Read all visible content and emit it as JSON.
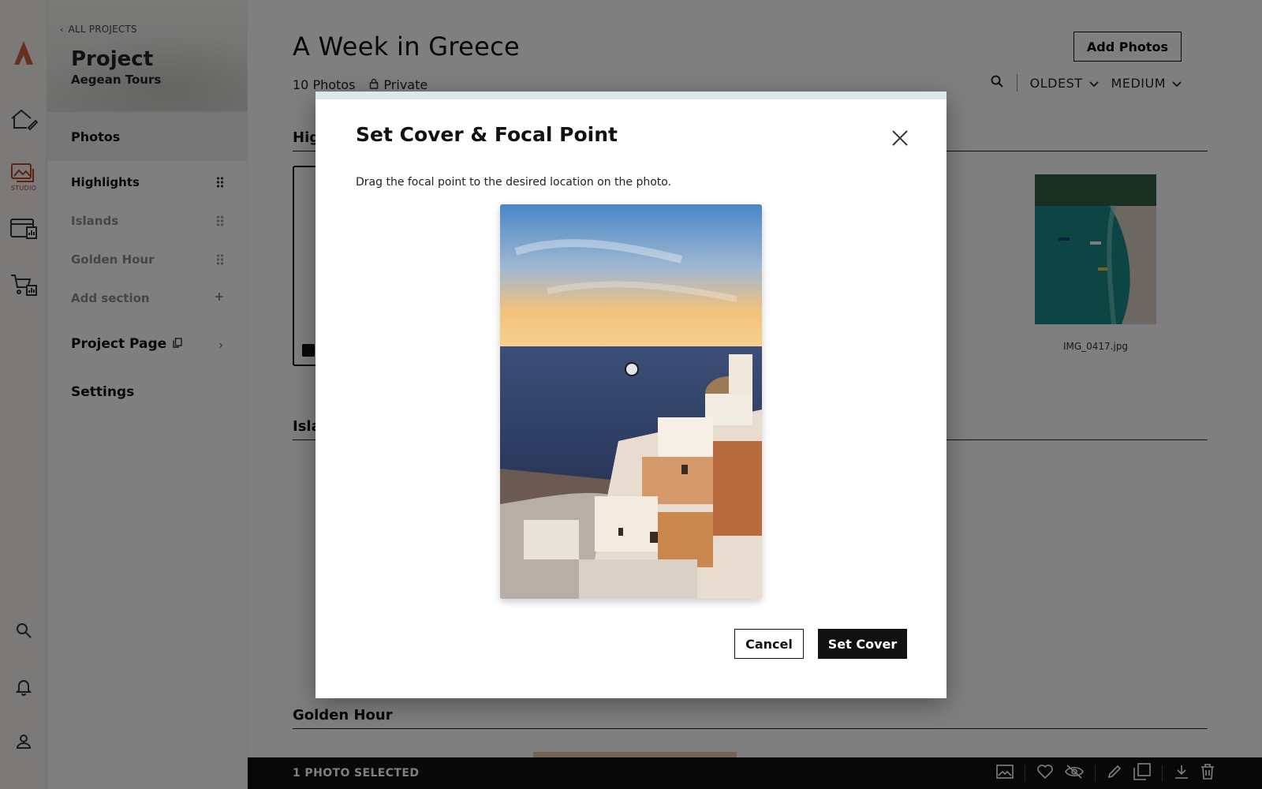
{
  "rail": {
    "studio_label": "STUDIO",
    "accent": "#b8442c",
    "icons": [
      "logo-icon",
      "home-edit-icon",
      "studio-photos-icon",
      "website-icon",
      "store-icon",
      "search-icon",
      "bell-icon",
      "user-icon"
    ]
  },
  "sidebar": {
    "back_label": "ALL PROJECTS",
    "kicker": "Project",
    "project_name": "Aegean Tours",
    "photos_label": "Photos",
    "sections": [
      {
        "label": "Highlights"
      },
      {
        "label": "Islands"
      },
      {
        "label": "Golden Hour"
      }
    ],
    "add_section_label": "Add section",
    "project_page_label": "Project Page",
    "settings_label": "Settings"
  },
  "main": {
    "title": "A Week in Greece",
    "photo_count": "10 Photos",
    "privacy": "Private",
    "add_photos_label": "Add Photos",
    "sort_label": "OLDEST",
    "size_label": "MEDIUM",
    "section_headers": [
      "Hig",
      "Isla",
      "Golden Hour"
    ],
    "thumb_name": "IMG_0417.jpg",
    "selected_text": "1 PHOTO SELECTED"
  },
  "modal": {
    "title": "Set Cover & Focal Point",
    "description": "Drag the focal point to the desired location on the photo.",
    "cancel_label": "Cancel",
    "confirm_label": "Set Cover"
  }
}
